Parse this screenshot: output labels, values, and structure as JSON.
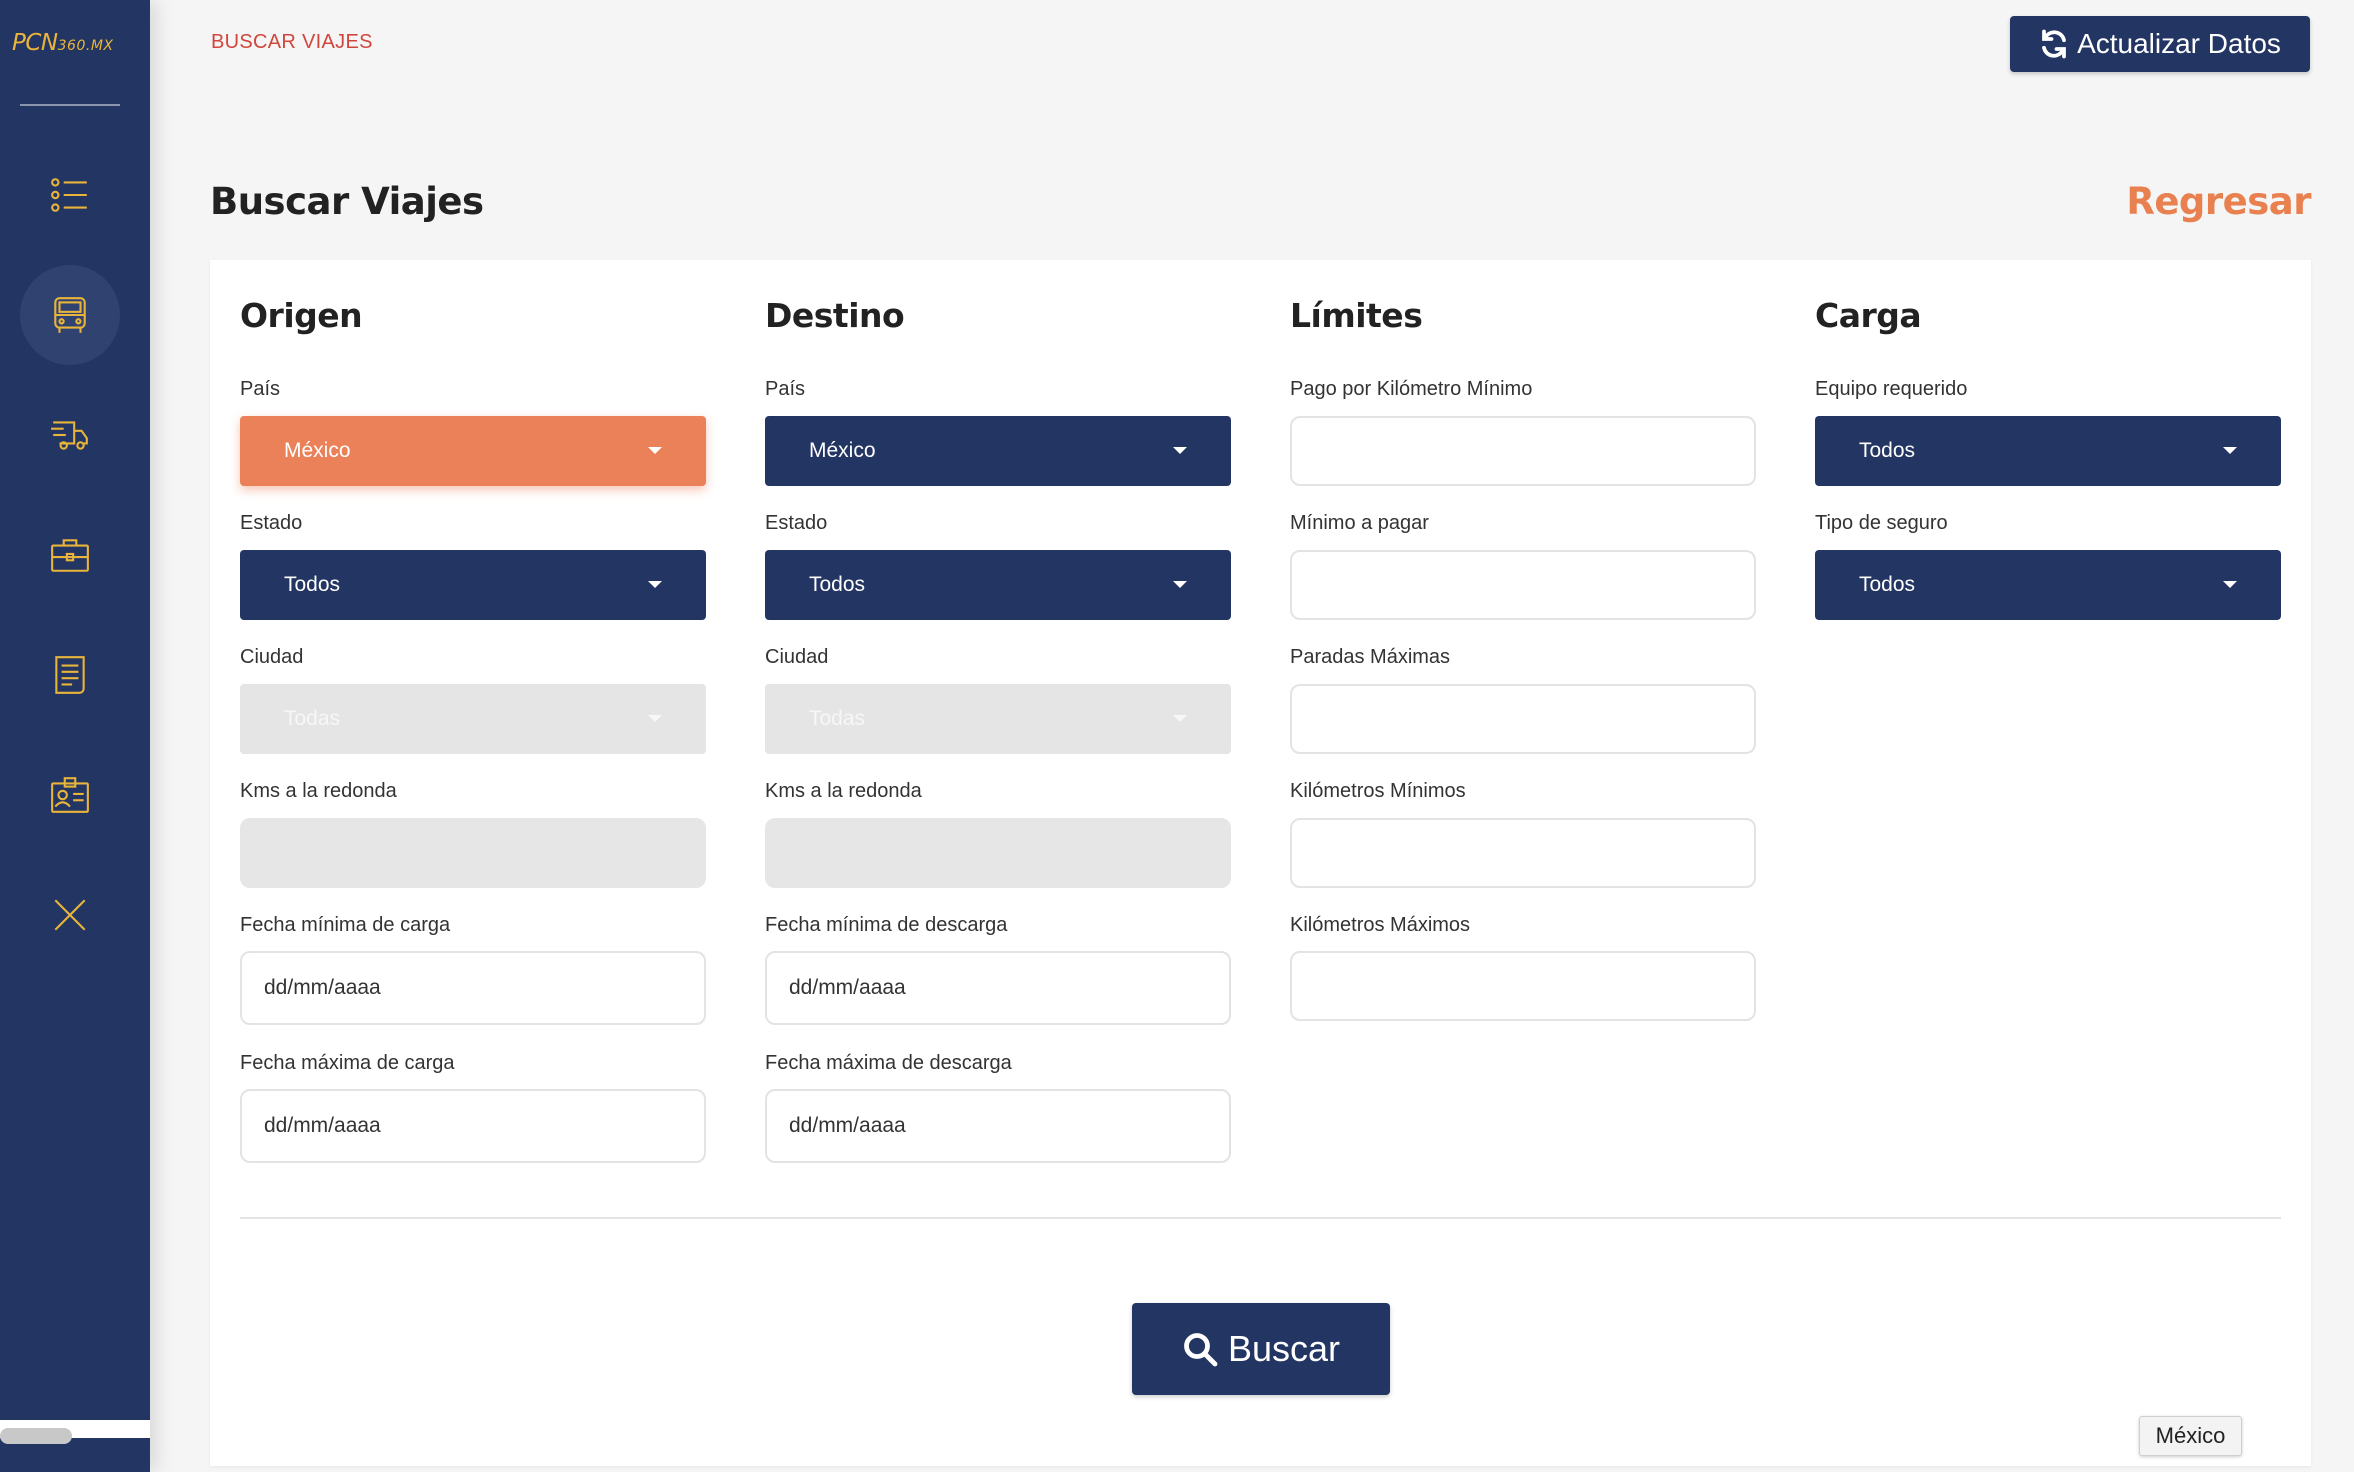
{
  "app": {
    "logo_main": "PCN",
    "logo_suffix": "360.MX"
  },
  "sidebar": {
    "items": [
      {
        "icon": "list-icon"
      },
      {
        "icon": "bus-icon",
        "active": true
      },
      {
        "icon": "truck-icon"
      },
      {
        "icon": "briefcase-icon"
      },
      {
        "icon": "document-icon"
      },
      {
        "icon": "id-badge-icon"
      },
      {
        "icon": "close-icon"
      }
    ]
  },
  "header": {
    "breadcrumb": "BUSCAR VIAJES",
    "refresh_label": "Actualizar Datos"
  },
  "page": {
    "title": "Buscar Viajes",
    "back_label": "Regresar"
  },
  "origen": {
    "title": "Origen",
    "pais_label": "País",
    "pais_value": "México",
    "estado_label": "Estado",
    "estado_value": "Todos",
    "ciudad_label": "Ciudad",
    "ciudad_value": "Todas",
    "kms_label": "Kms a la redonda",
    "fecha_min_label": "Fecha mínima de carga",
    "fecha_min_placeholder": "dd/mm/aaaa",
    "fecha_max_label": "Fecha máxima de carga",
    "fecha_max_placeholder": "dd/mm/aaaa"
  },
  "destino": {
    "title": "Destino",
    "pais_label": "País",
    "pais_value": "México",
    "estado_label": "Estado",
    "estado_value": "Todos",
    "ciudad_label": "Ciudad",
    "ciudad_value": "Todas",
    "kms_label": "Kms a la redonda",
    "fecha_min_label": "Fecha mínima de descarga",
    "fecha_min_placeholder": "dd/mm/aaaa",
    "fecha_max_label": "Fecha máxima de descarga",
    "fecha_max_placeholder": "dd/mm/aaaa"
  },
  "limites": {
    "title": "Límites",
    "pago_km_label": "Pago por Kilómetro Mínimo",
    "minimo_pagar_label": "Mínimo a pagar",
    "paradas_label": "Paradas Máximas",
    "km_min_label": "Kilómetros Mínimos",
    "km_max_label": "Kilómetros Máximos"
  },
  "carga": {
    "title": "Carga",
    "equipo_label": "Equipo requerido",
    "equipo_value": "Todos",
    "seguro_label": "Tipo de seguro",
    "seguro_value": "Todos"
  },
  "actions": {
    "search_label": "Buscar"
  },
  "tooltip": {
    "text": "México"
  },
  "colors": {
    "navy": "#233563",
    "accent_orange": "#ea8159",
    "breadcrumb_red": "#d0463c",
    "icon_gold": "#e9b43a"
  }
}
